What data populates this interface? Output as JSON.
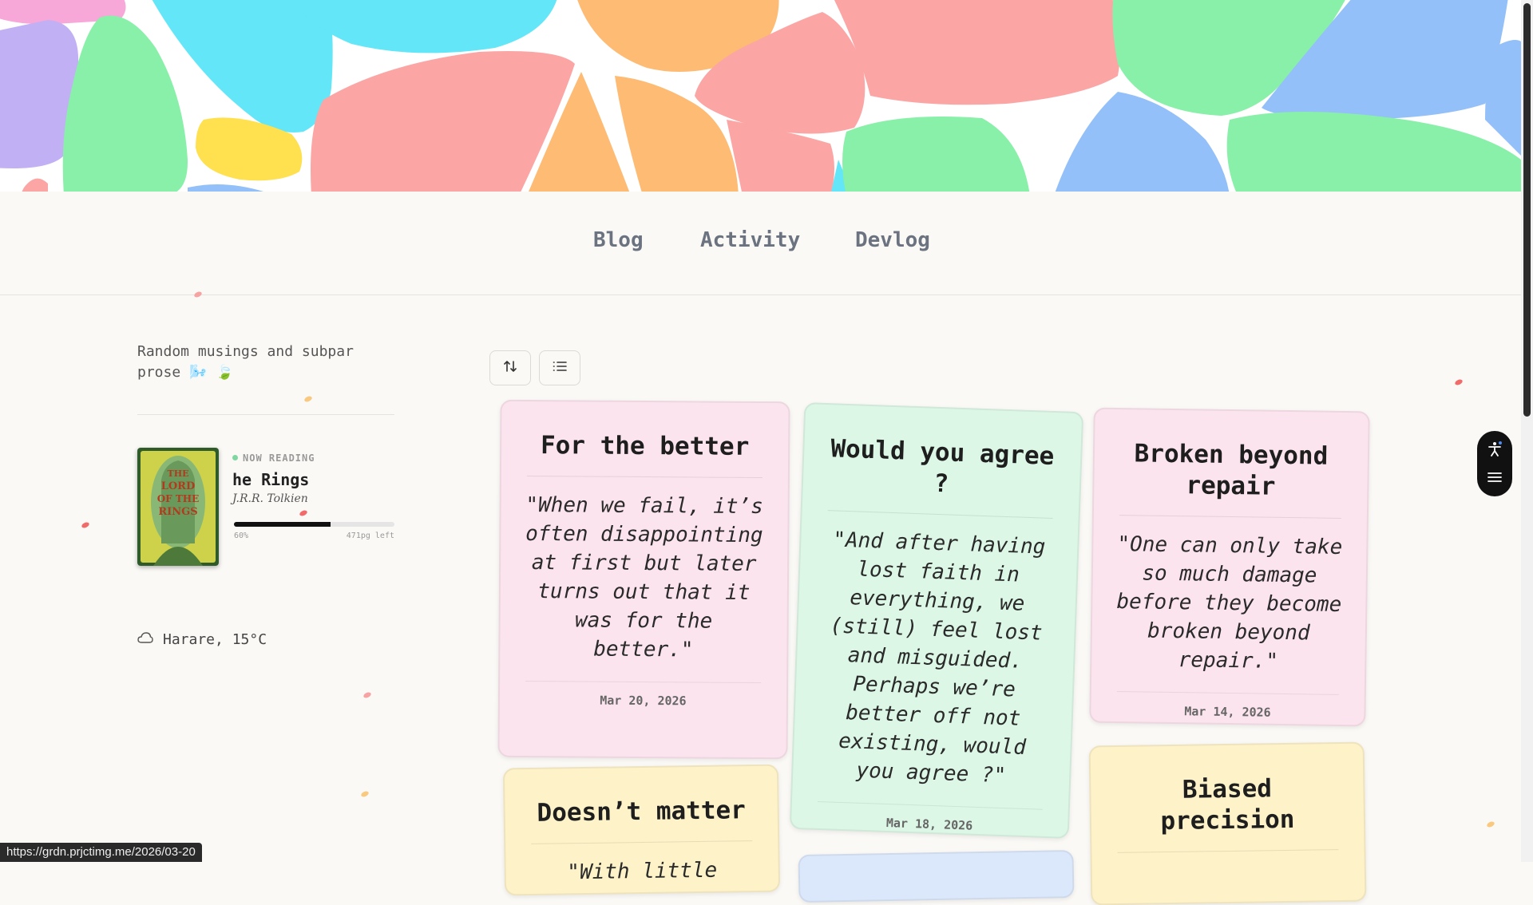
{
  "nav": {
    "items": [
      "Blog",
      "Activity",
      "Devlog"
    ]
  },
  "sidebar": {
    "tagline": "Random musings and subpar prose 🌬️ 🍃",
    "now_reading": {
      "label": "NOW READING",
      "title": "he Rings",
      "author": "J.R.R. Tolkien",
      "progress_pct": 60,
      "progress_text": "60%",
      "pages_left": "471pg left",
      "cover_text": "THE LORD OF THE RINGS"
    },
    "weather": {
      "icon": "cloud-icon",
      "text": "Harare, 15°C"
    }
  },
  "toolbar": {
    "sort_icon": "sort-arrows-icon",
    "view_icon": "list-view-icon"
  },
  "posts": [
    {
      "title": "For the better",
      "quote": "\"When we fail, it’s often disappointing at first but later turns out that it was for the better.\"",
      "date": "Mar 20, 2026",
      "color": "pink"
    },
    {
      "title": "Would you agree ?",
      "quote": "\"And after having lost faith in everything, we (still) feel lost and misguided. Perhaps we’re better off not existing, would you agree ?\"",
      "date": "Mar 18, 2026",
      "color": "green"
    },
    {
      "title": "Broken beyond repair",
      "quote": "\"One can only take so much damage before they become broken beyond repair.\"",
      "date": "Mar 14, 2026",
      "color": "pink"
    },
    {
      "title": "Doesn’t matter",
      "quote": "\"With little",
      "date": "",
      "color": "yellow"
    },
    {
      "title": "Biased precision",
      "quote": "",
      "date": "",
      "color": "yellow"
    }
  ],
  "status_bar": {
    "url": "https://grdn.prjctimg.me/2026/03-20"
  },
  "colors": {
    "background": "#fbf9f6",
    "nav_text": "#6b7380",
    "card_pink": "#fce4ee",
    "card_green": "#dcf7e6",
    "card_yellow": "#fdf2c8"
  }
}
